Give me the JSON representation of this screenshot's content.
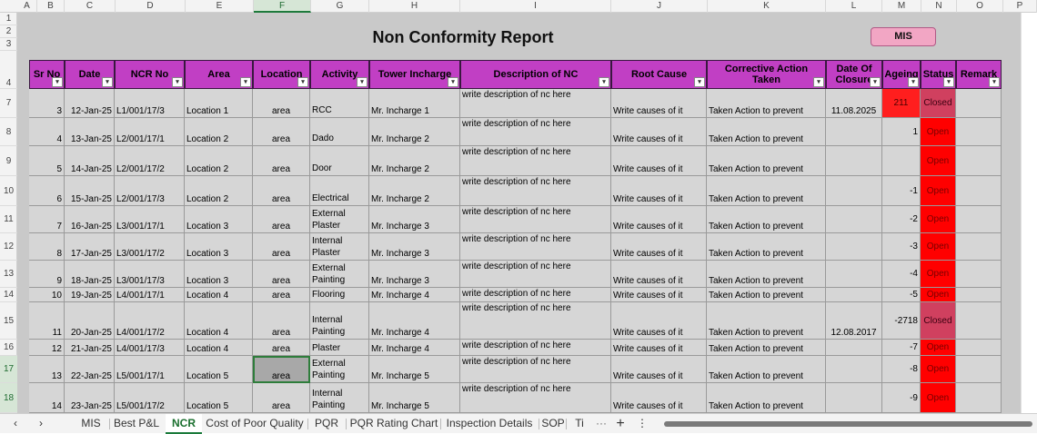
{
  "columns": [
    "A",
    "B",
    "C",
    "D",
    "E",
    "F",
    "G",
    "H",
    "I",
    "J",
    "K",
    "L",
    "M",
    "N",
    "O",
    "P"
  ],
  "selected_column": "F",
  "rows": [
    "1",
    "2",
    "3",
    "4",
    "7",
    "8",
    "9",
    "10",
    "11",
    "12",
    "13",
    "14",
    "15",
    "16",
    "17",
    "18"
  ],
  "selected_rows": [
    "17",
    "18"
  ],
  "report_title": "Non Conformity Report",
  "mis_button": "MIS",
  "headers": [
    "Sr No",
    "Date",
    "NCR No",
    "Area",
    "Location",
    "Activity",
    "Tower Incharge",
    "Description of NC",
    "Root Cause",
    "Corrective Action Taken",
    "Date Of Closure",
    "Ageing",
    "Status",
    "Remark"
  ],
  "filter_icon": "▾",
  "records": [
    {
      "sr": "3",
      "date": "12-Jan-25",
      "ncr": "L1/001/17/3",
      "area": "Location 1",
      "loc": "area",
      "act": "RCC",
      "inch": "Mr. Incharge 1",
      "desc": "write description of nc here",
      "cause": "Write causes of it",
      "action": "Taken Action to prevent",
      "closure": "11.08.2025",
      "age": "211",
      "status": "Closed"
    },
    {
      "sr": "4",
      "date": "13-Jan-25",
      "ncr": "L2/001/17/1",
      "area": "Location 2",
      "loc": "area",
      "act": "Dado",
      "inch": "Mr. Incharge 2",
      "desc": "write description of nc here",
      "cause": "Write causes of it",
      "action": "Taken Action to prevent",
      "closure": "",
      "age": "1",
      "status": "Open"
    },
    {
      "sr": "5",
      "date": "14-Jan-25",
      "ncr": "L2/001/17/2",
      "area": "Location 2",
      "loc": "area",
      "act": "Door",
      "inch": "Mr. Incharge 2",
      "desc": "write description of nc here",
      "cause": "Write causes of it",
      "action": "Taken Action to prevent",
      "closure": "",
      "age": "",
      "status": "Open"
    },
    {
      "sr": "6",
      "date": "15-Jan-25",
      "ncr": "L2/001/17/3",
      "area": "Location 2",
      "loc": "area",
      "act": "Electrical",
      "inch": "Mr. Incharge 2",
      "desc": "write description of nc here",
      "cause": "Write causes of it",
      "action": "Taken Action to prevent",
      "closure": "",
      "age": "-1",
      "status": "Open"
    },
    {
      "sr": "7",
      "date": "16-Jan-25",
      "ncr": "L3/001/17/1",
      "area": "Location 3",
      "loc": "area",
      "act": "External Plaster",
      "inch": "Mr. Incharge 3",
      "desc": "write description of nc here",
      "cause": "Write causes of it",
      "action": "Taken Action to prevent",
      "closure": "",
      "age": "-2",
      "status": "Open"
    },
    {
      "sr": "8",
      "date": "17-Jan-25",
      "ncr": "L3/001/17/2",
      "area": "Location 3",
      "loc": "area",
      "act": "Internal Plaster",
      "inch": "Mr. Incharge 3",
      "desc": "write description of nc here",
      "cause": "Write causes of it",
      "action": "Taken Action to prevent",
      "closure": "",
      "age": "-3",
      "status": "Open"
    },
    {
      "sr": "9",
      "date": "18-Jan-25",
      "ncr": "L3/001/17/3",
      "area": "Location 3",
      "loc": "area",
      "act": "External Painting",
      "inch": "Mr. Incharge 3",
      "desc": "write description of nc here",
      "cause": "Write causes of it",
      "action": "Taken Action to prevent",
      "closure": "",
      "age": "-4",
      "status": "Open"
    },
    {
      "sr": "10",
      "date": "19-Jan-25",
      "ncr": "L4/001/17/1",
      "area": "Location 4",
      "loc": "area",
      "act": "Flooring",
      "inch": "Mr. Incharge 4",
      "desc": "write description of nc here",
      "cause": "Write causes of it",
      "action": "Taken Action to prevent",
      "closure": "",
      "age": "-5",
      "status": "Open"
    },
    {
      "sr": "11",
      "date": "20-Jan-25",
      "ncr": "L4/001/17/2",
      "area": "Location 4",
      "loc": "area",
      "act": "Internal Painting",
      "inch": "Mr. Incharge 4",
      "desc": "write description of nc here",
      "cause": "Write causes of it",
      "action": "Taken Action to prevent",
      "closure": "12.08.2017",
      "age": "-2718",
      "status": "Closed"
    },
    {
      "sr": "12",
      "date": "21-Jan-25",
      "ncr": "L4/001/17/3",
      "area": "Location 4",
      "loc": "area",
      "act": "Internal Plaster",
      "inch": "Mr. Incharge 4",
      "desc": "write description of nc here",
      "cause": "Write causes of it",
      "action": "Taken Action to prevent",
      "closure": "",
      "age": "-7",
      "status": "Open"
    },
    {
      "sr": "13",
      "date": "22-Jan-25",
      "ncr": "L5/001/17/1",
      "area": "Location 5",
      "loc": "area",
      "act": "External Painting",
      "inch": "Mr. Incharge 5",
      "desc": "write description of nc here",
      "cause": "Write causes of it",
      "action": "Taken Action to prevent",
      "closure": "",
      "age": "-8",
      "status": "Open"
    },
    {
      "sr": "14",
      "date": "23-Jan-25",
      "ncr": "L5/001/17/2",
      "area": "Location 5",
      "loc": "area",
      "act": "Internal Painting",
      "inch": "Mr. Incharge 5",
      "desc": "write description of nc here",
      "cause": "Write causes of it",
      "action": "Taken Action to prevent",
      "closure": "",
      "age": "-9",
      "status": "Open"
    }
  ],
  "sheet_tabs": [
    "MIS",
    "Best P&L",
    "NCR",
    "Cost of Poor Quality",
    "PQR",
    "PQR Rating Chart",
    "Inspection Details",
    "SOP",
    "Ti"
  ],
  "active_tab": "NCR",
  "nav_icons": {
    "prev": "‹",
    "next": "›",
    "add": "+",
    "more": "⋮",
    "overflow": "···"
  }
}
